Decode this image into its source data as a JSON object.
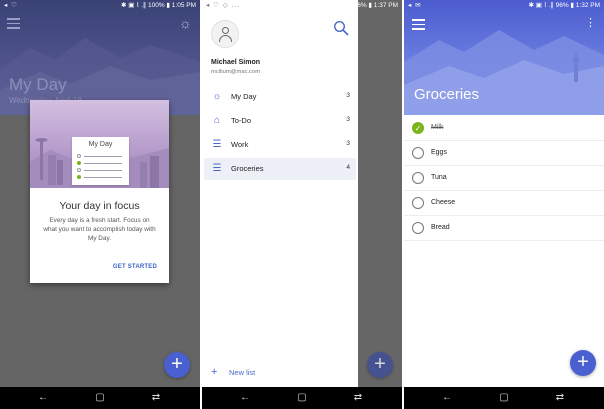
{
  "colors": {
    "accent_blue": "#4968c8",
    "complete_green": "#7bb31a",
    "fab_blue": "#4a5fd0"
  },
  "phone1": {
    "status": {
      "left_icons": "◂ ♡",
      "right": "✱ ▣ ⌇ .∥ 100% ▮ 1:05 PM"
    },
    "menu_icon": "hamburger-icon",
    "settings_icon": "sun-icon",
    "title": "My Day",
    "date": "Wednesday, April 18",
    "dialog": {
      "card_title": "My Day",
      "heading": "Your day in focus",
      "body": "Every day is a fresh start. Focus on what you want to accomplish today with My Day.",
      "button": "GET STARTED"
    },
    "fab": "+"
  },
  "phone2": {
    "status": {
      "left_icons": "◂ ♡ ◇ ...",
      "right": "✱ ▣ ⌇ .∥ 96% ▮ 1:37 PM"
    },
    "user": {
      "name": "Michael Simon",
      "email": "mcilium@mac.com"
    },
    "nav": [
      {
        "label": "My Day",
        "count": "3",
        "icon": "sun-icon"
      },
      {
        "label": "To-Do",
        "count": "3",
        "icon": "home-icon"
      },
      {
        "label": "Work",
        "count": "3",
        "icon": "list-icon"
      },
      {
        "label": "Groceries",
        "count": "4",
        "icon": "list-icon"
      }
    ],
    "new_list": "New list",
    "fab": "+"
  },
  "phone3": {
    "status": {
      "left_icons": "◂ ✉",
      "right": "✱ ▣ ⌇ .∥ 96% ▮ 1:32 PM"
    },
    "title": "Groceries",
    "tasks": [
      {
        "label": "Milk",
        "done": true
      },
      {
        "label": "Eggs",
        "done": false
      },
      {
        "label": "Tuna",
        "done": false
      },
      {
        "label": "Cheese",
        "done": false
      },
      {
        "label": "Bread",
        "done": false
      }
    ],
    "fab": "+"
  },
  "navbar": {
    "back": "←",
    "home": "▢",
    "recents": "⇄"
  }
}
